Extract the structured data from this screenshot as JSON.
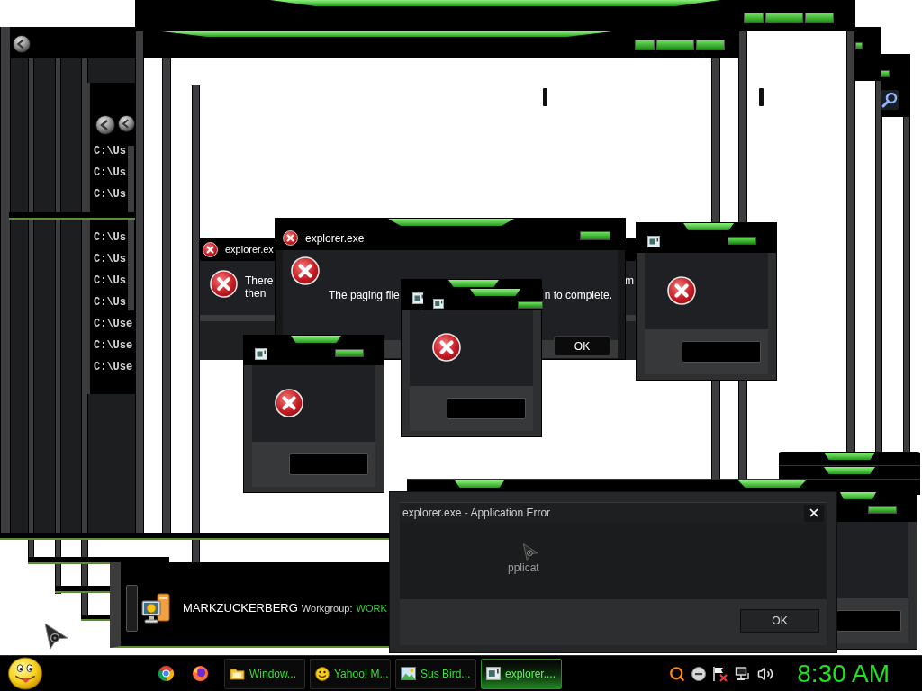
{
  "console": {
    "upper_lines": [
      "C:\\Us",
      "C:\\Us",
      "C:\\Us"
    ],
    "lower_lines": [
      "C:\\Us",
      "C:\\Us",
      "C:\\Us",
      "C:\\Us",
      "C:\\Use",
      "C:\\Use",
      "C:\\Use"
    ]
  },
  "back_error_dialog": {
    "title": "explorer.ex",
    "message_lines": [
      "There",
      "then"
    ],
    "message_tail": "m"
  },
  "front_error_dialog": {
    "title": "explorer.exe",
    "message_fragments": [
      "The paging file",
      "n to complete."
    ],
    "button": "OK"
  },
  "application_error_dialog": {
    "title": "explorer.exe - Application Error",
    "message": "pplicat",
    "button": "OK"
  },
  "computer_panel": {
    "computer_name": "MARKZUCKERBERG",
    "workgroup_label": "Workgroup:",
    "workgroup": "WORK"
  },
  "taskbar": {
    "tasks": [
      {
        "label": "Window...",
        "selected": false
      },
      {
        "label": "Yahoo! M...",
        "selected": false
      },
      {
        "label": "Sus Bird...",
        "selected": false
      },
      {
        "label": "explorer....",
        "selected": true
      }
    ],
    "clock": "8:30 AM"
  }
}
